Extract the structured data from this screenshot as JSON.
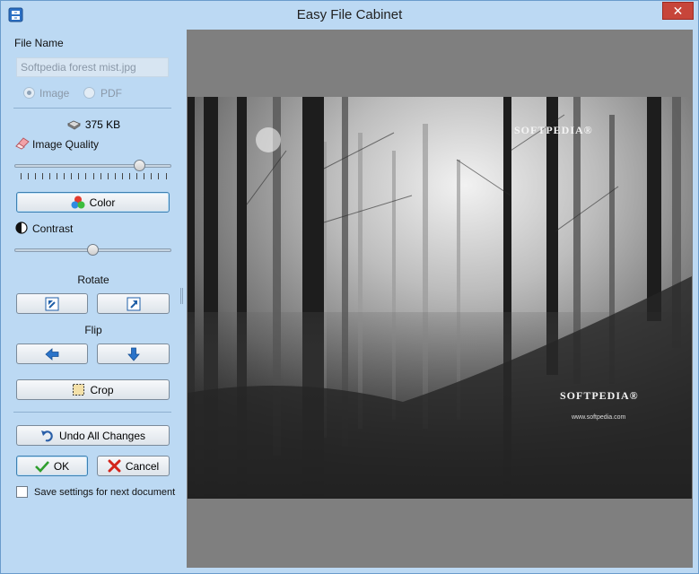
{
  "window": {
    "title": "Easy File Cabinet",
    "close_glyph": "✕",
    "icon": "cabinet-icon"
  },
  "left_panel": {
    "file_name_label": "File Name",
    "file_name_value": "Softpedia forest mist.jpg",
    "format_options": [
      {
        "label": "Image",
        "selected": true
      },
      {
        "label": "PDF",
        "selected": false
      }
    ],
    "file_size": "375 KB",
    "image_quality_label": "Image Quality",
    "image_quality_level": 0.82,
    "color_button_label": "Color",
    "contrast_label": "Contrast",
    "contrast_level": 0.5,
    "rotate_label": "Rotate",
    "flip_label": "Flip",
    "crop_button_label": "Crop",
    "undo_button_label": "Undo All Changes",
    "ok_button_label": "OK",
    "cancel_button_label": "Cancel",
    "save_settings_label": "Save settings for next document",
    "save_settings_checked": false
  },
  "preview": {
    "watermarks": [
      "SOFTPEDIA®",
      "SOFTPEDIA®"
    ],
    "watermark_url": "www.softpedia.com"
  },
  "colors": {
    "panel_bg": "#bcd9f3",
    "view_bg": "#7f7f7f",
    "close_red": "#c7453a"
  }
}
